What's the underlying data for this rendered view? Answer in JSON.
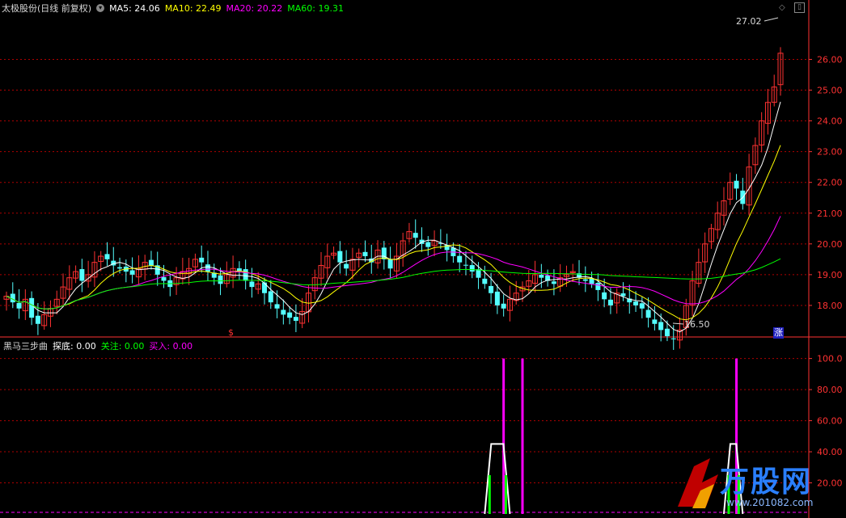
{
  "main_panel": {
    "title": "太极股份(日线 前复权)",
    "ma_labels": [
      {
        "text": "MA5: 24.06",
        "color": "#ffffff"
      },
      {
        "text": "MA10: 22.49",
        "color": "#ffff00"
      },
      {
        "text": "MA20: 20.22",
        "color": "#ff00ff"
      },
      {
        "text": "MA60: 19.31",
        "color": "#00ff00"
      }
    ],
    "high_marker": "27.02",
    "low_marker": "16.50",
    "signal_text": "涨",
    "bottom_mark": "$",
    "y_ticks": [
      "26.00",
      "25.00",
      "24.00",
      "23.00",
      "22.00",
      "21.00",
      "20.00",
      "19.00",
      "18.00"
    ]
  },
  "sub_panel": {
    "title": "黑马三步曲",
    "labels": [
      {
        "text": "探底: 0.00",
        "color": "#ffffff"
      },
      {
        "text": "关注: 0.00",
        "color": "#00ff00"
      },
      {
        "text": "买入: 0.00",
        "color": "#ff00ff"
      }
    ],
    "y_ticks": [
      "100.0",
      "80.00",
      "60.00",
      "40.00",
      "20.00"
    ]
  },
  "watermark": {
    "brand": "万股网",
    "url": "www.201082.com"
  },
  "colors": {
    "up": "#ff3232",
    "down": "#54ffff",
    "grid": "#b00000",
    "axis": "#ff3232"
  },
  "chart_data": {
    "type": "candlestick",
    "ylim": [
      17.0,
      27.3
    ],
    "close_series": [
      18.3,
      18.1,
      17.9,
      18.2,
      17.6,
      17.4,
      17.7,
      17.9,
      18.2,
      18.6,
      18.9,
      19.1,
      18.8,
      19.0,
      19.4,
      19.6,
      19.5,
      19.3,
      19.2,
      19.1,
      19.0,
      19.2,
      19.4,
      19.3,
      19.0,
      18.8,
      18.6,
      18.9,
      19.1,
      19.2,
      19.5,
      19.4,
      19.1,
      18.9,
      18.7,
      19.0,
      19.2,
      19.1,
      18.8,
      18.6,
      18.7,
      18.4,
      18.1,
      17.9,
      17.7,
      17.6,
      17.5,
      17.8,
      18.4,
      18.9,
      19.3,
      19.6,
      19.7,
      19.4,
      19.2,
      19.5,
      19.7,
      19.6,
      19.4,
      19.8,
      19.5,
      19.2,
      19.6,
      20.1,
      20.4,
      20.2,
      20.0,
      19.9,
      20.1,
      20.0,
      19.8,
      19.6,
      19.4,
      19.3,
      19.1,
      18.9,
      18.7,
      18.4,
      18.0,
      17.9,
      18.2,
      18.4,
      18.6,
      18.8,
      19.0,
      18.9,
      18.8,
      18.7,
      18.9,
      19.0,
      19.1,
      18.9,
      18.8,
      18.7,
      18.5,
      18.2,
      18.0,
      18.4,
      18.3,
      18.1,
      18.0,
      17.9,
      17.6,
      17.4,
      17.2,
      17.0,
      16.9,
      17.2,
      18.0,
      18.8,
      19.4,
      20.0,
      20.5,
      21.0,
      21.4,
      22.0,
      21.8,
      21.3,
      22.5,
      23.2,
      24.0,
      24.6,
      25.1,
      26.2
    ],
    "ma_series": [
      {
        "name": "MA5",
        "color": "#ffffff"
      },
      {
        "name": "MA10",
        "color": "#ffff00"
      },
      {
        "name": "MA20",
        "color": "#ff00ff"
      },
      {
        "name": "MA60",
        "color": "#00ff00"
      }
    ],
    "sub_spikes": [
      {
        "bar": 79,
        "magenta": 100,
        "green": 25,
        "white": 45
      },
      {
        "bar": 82,
        "magenta": 100,
        "green": 25,
        "white": 45
      },
      {
        "bar": 116,
        "magenta": 100,
        "green": 25,
        "white": 45
      }
    ],
    "sub_ylim": [
      0,
      105
    ]
  }
}
